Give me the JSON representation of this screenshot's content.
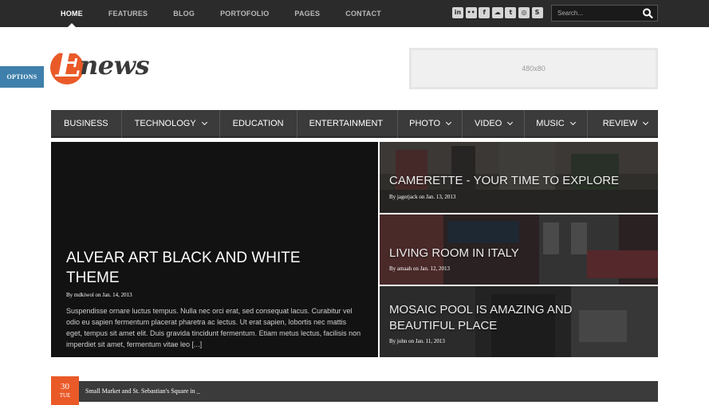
{
  "topnav": {
    "items": [
      {
        "label": "HOME"
      },
      {
        "label": "FEATURES"
      },
      {
        "label": "BLOG"
      },
      {
        "label": "PORTOFOLIO"
      },
      {
        "label": "PAGES"
      },
      {
        "label": "CONTACT"
      }
    ],
    "active": "HOME"
  },
  "social": [
    {
      "icon": "linkedin-icon",
      "glyph": "in"
    },
    {
      "icon": "flickr-icon",
      "glyph": "••"
    },
    {
      "icon": "facebook-icon",
      "glyph": "f"
    },
    {
      "icon": "soundcloud-icon",
      "glyph": "☁"
    },
    {
      "icon": "twitter-icon",
      "glyph": "t"
    },
    {
      "icon": "dribbble-icon",
      "glyph": "◎"
    },
    {
      "icon": "skype-icon",
      "glyph": "S"
    }
  ],
  "search": {
    "placeholder": "Search...",
    "icon": "search-icon"
  },
  "options": {
    "label": "OPTIONS"
  },
  "logo": {
    "initial": "E",
    "rest": "news",
    "accent": "#ea5a29"
  },
  "ad": {
    "label": "480x80"
  },
  "categories": [
    {
      "label": "BUSINESS",
      "dropdown": false
    },
    {
      "label": "TECHNOLOGY",
      "dropdown": true
    },
    {
      "label": "EDUCATION",
      "dropdown": false
    },
    {
      "label": "ENTERTAINMENT",
      "dropdown": false
    },
    {
      "label": "PHOTO",
      "dropdown": true
    },
    {
      "label": "VIDEO",
      "dropdown": true
    },
    {
      "label": "MUSIC",
      "dropdown": true
    },
    {
      "label": "REVIEW",
      "dropdown": true
    }
  ],
  "featured": {
    "main": {
      "title": "ALVEAR ART BLACK AND WHITE THEME",
      "meta": "By mdkiwol on Jan. 14, 2013",
      "excerpt": "Suspendisse ornare luctus tempus. Nulla nec orci erat, sed consequat lacus. Curabitur vel odio eu sapien fermentum placerat pharetra ac lectus. Ut erat sapien, lobortis nec mattis eget, tempus sit amet elit. Duis gravida tincidunt fermentum. Etiam metus lectus, facilisis non imperdiet sit amet, fermentum vitae leo [...]"
    },
    "side": [
      {
        "title": "CAMERETTE - YOUR TIME TO EXPLORE",
        "meta": "By jagerjack on Jan. 13, 2013"
      },
      {
        "title": "LIVING ROOM IN ITALY",
        "meta": "By amaah on Jan. 12, 2013"
      },
      {
        "title": "MOSAIC POOL IS AMAZING AND BEAUTIFUL PLACE",
        "meta": "By john on Jan. 11, 2013"
      }
    ]
  },
  "ticker": {
    "day": "30",
    "weekday": "TUE",
    "headline": "Small Market and St. Sebastian's Square in _"
  },
  "colors": {
    "accent": "#ea5a29",
    "options_tab": "#3f7fab",
    "nav_bg": "#3b3b3b",
    "topbar": "#2b2b2b"
  }
}
